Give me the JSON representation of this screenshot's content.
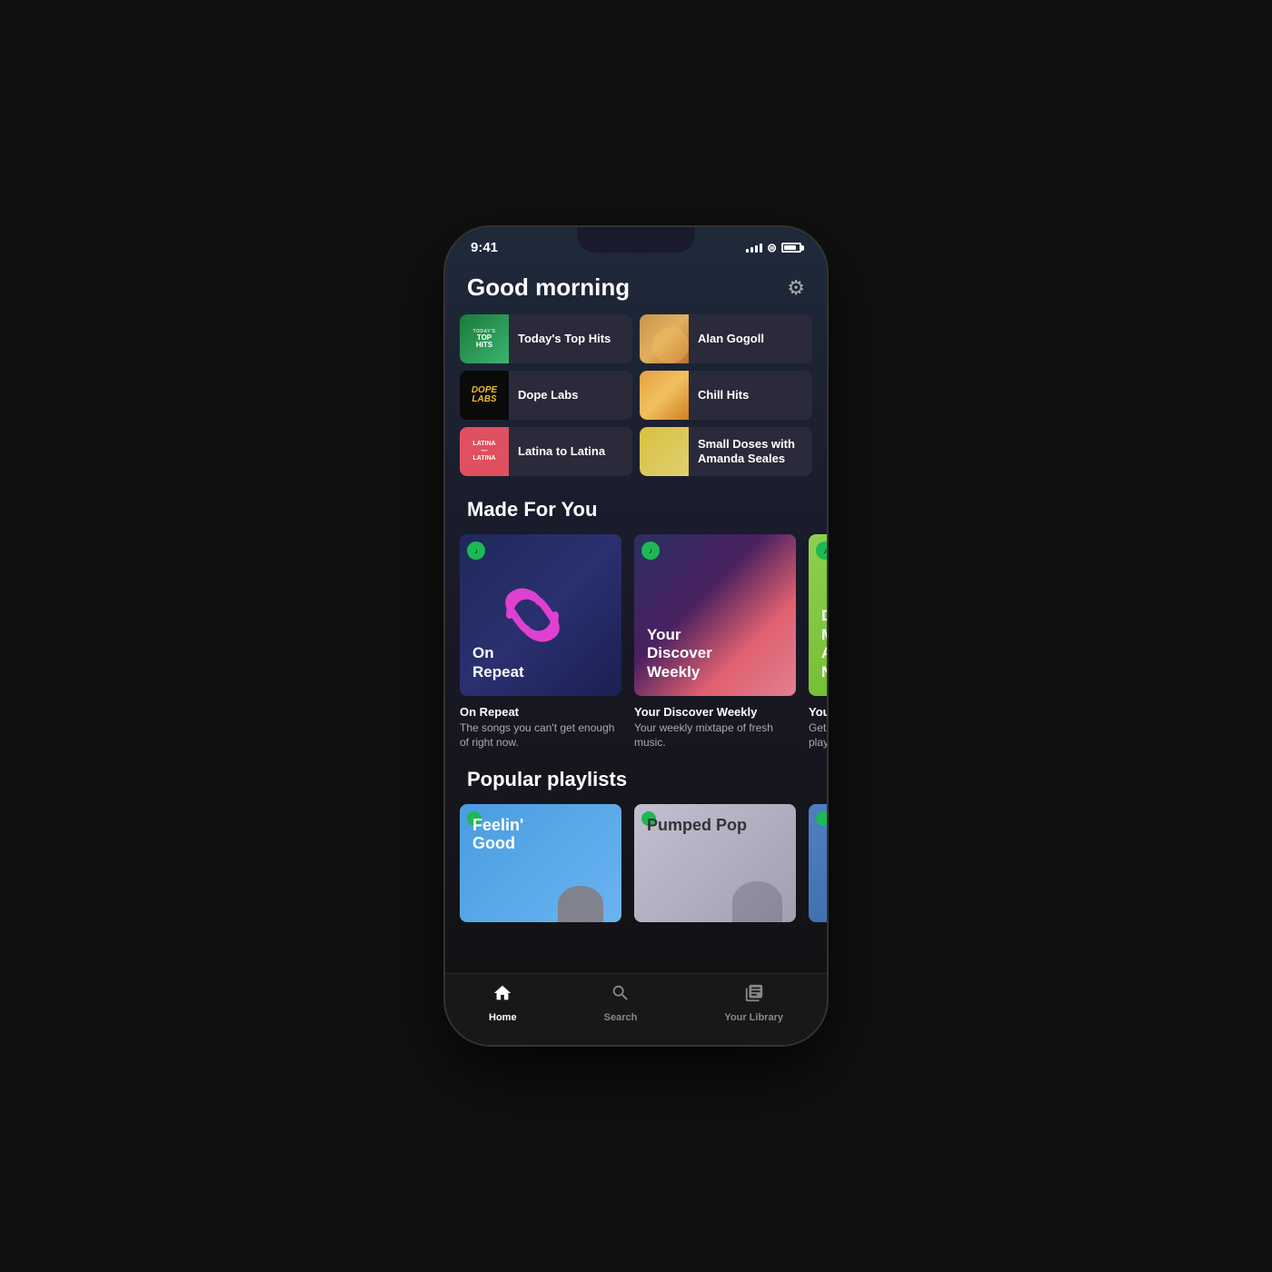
{
  "status": {
    "time": "9:41",
    "signal": "signal",
    "wifi": "wifi",
    "battery": "battery"
  },
  "header": {
    "greeting": "Good morning",
    "settings_icon": "⚙"
  },
  "quick_items": [
    {
      "id": "todays-top-hits",
      "label": "Today's Top Hits",
      "thumb_type": "top-hits"
    },
    {
      "id": "alan-gogoll",
      "label": "Alan Gogoll",
      "thumb_type": "alan"
    },
    {
      "id": "dope-labs",
      "label": "Dope Labs",
      "thumb_type": "dope"
    },
    {
      "id": "chill-hits",
      "label": "Chill Hits",
      "thumb_type": "chill"
    },
    {
      "id": "latina-to-latina",
      "label": "Latina to Latina",
      "thumb_type": "latina"
    },
    {
      "id": "small-doses",
      "label": "Small Doses with Amanda Seales",
      "thumb_type": "small-doses"
    }
  ],
  "made_for_you": {
    "section_title": "Made For You",
    "cards": [
      {
        "id": "on-repeat",
        "title": "On Repeat",
        "description": "The songs you can't get enough of right now.",
        "label": "On\nRepeat"
      },
      {
        "id": "discover-weekly",
        "title": "Your Discover Weekly",
        "description": "Your weekly mixtape of fresh music.",
        "label": "Your\nDiscover\nWeekly"
      },
      {
        "id": "daily-mix",
        "title": "Your...",
        "description": "Get...\nplay...",
        "label": "D\nMU\nAN\nNE"
      }
    ]
  },
  "popular_playlists": {
    "section_title": "Popular playlists",
    "cards": [
      {
        "id": "feelin-good",
        "title": "Feelin' Good",
        "label": "Feelin'\nGood"
      },
      {
        "id": "pumped-pop",
        "title": "Pumped Pop",
        "label": "Pumped Pop"
      },
      {
        "id": "partial-card",
        "title": ""
      }
    ]
  },
  "bottom_nav": {
    "items": [
      {
        "id": "home",
        "label": "Home",
        "icon": "home",
        "active": true
      },
      {
        "id": "search",
        "label": "Search",
        "icon": "search",
        "active": false
      },
      {
        "id": "library",
        "label": "Your Library",
        "icon": "library",
        "active": false
      }
    ]
  }
}
